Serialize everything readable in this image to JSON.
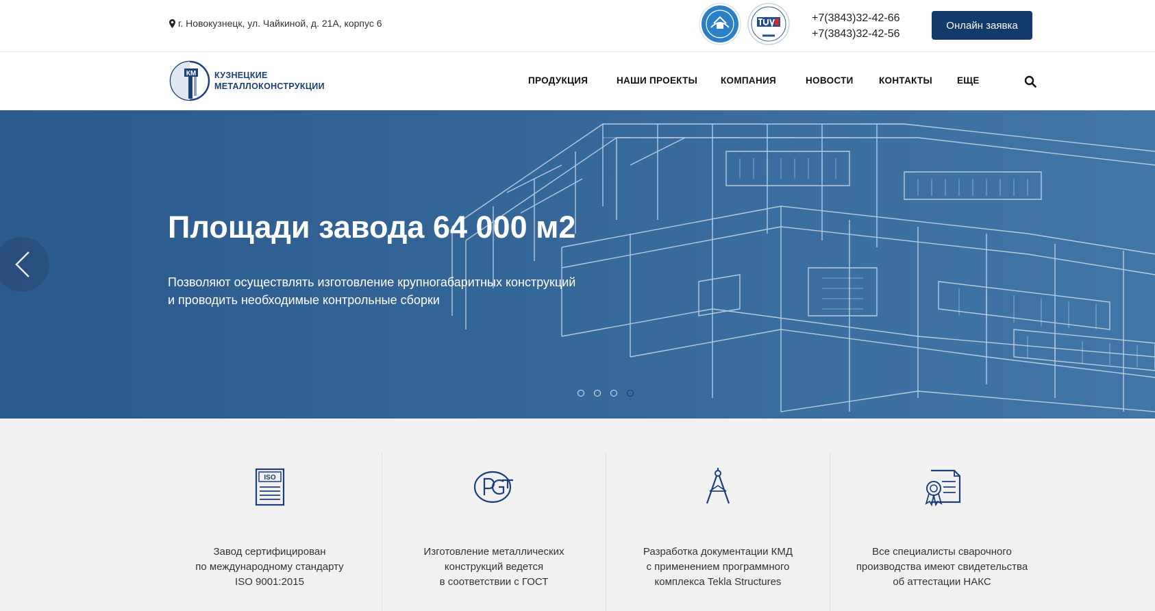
{
  "topbar": {
    "address": "г. Новокузнецк, ул. Чайкиной, д. 21А, корпус 6",
    "phones": [
      "+7(3843)32-42-66",
      "+7(3843)32-42-56"
    ],
    "cta_label": "Онлайн заявка"
  },
  "brand": {
    "logo_letters": "КМ",
    "line1": "КУЗНЕЦКИЕ",
    "line2": "МЕТАЛЛОКОНСТРУКЦИИ"
  },
  "nav": {
    "items": [
      {
        "label": "ПРОДУКЦИЯ"
      },
      {
        "label": "НАШИ ПРОЕКТЫ"
      },
      {
        "label": "КОМПАНИЯ"
      },
      {
        "label": "НОВОСТИ"
      },
      {
        "label": "КОНТАКТЫ"
      },
      {
        "label": "ЕЩЕ"
      }
    ]
  },
  "hero": {
    "title": "Площади завода 64 000 м2",
    "subtitle_line1": "Позволяют осуществлять изготовление крупногабаритных конструкций",
    "subtitle_line2": "и проводить необходимые контрольные сборки",
    "slide_count": 4,
    "active_slide": 4
  },
  "features": [
    {
      "icon": "iso-document-icon",
      "badge": "ISO",
      "lines": [
        "Завод сертифицирован",
        "по международному стандарту",
        "ISO 9001:2015"
      ]
    },
    {
      "icon": "gost-rst-icon",
      "lines": [
        "Изготовление металлических",
        "конструкций ведется",
        "в соответствии с ГОСТ"
      ]
    },
    {
      "icon": "drafting-compass-icon",
      "lines": [
        "Разработка документации КМД",
        "с применением программного",
        "комплекса Tekla Structures"
      ]
    },
    {
      "icon": "certificate-icon",
      "lines": [
        "Все специалисты сварочного",
        "производства имеют свидетельства",
        "об аттестации НАКС"
      ]
    }
  ],
  "colors": {
    "brand_navy": "#123a6b",
    "hero_blue": "#336596",
    "features_bg": "#f1f1f1"
  }
}
